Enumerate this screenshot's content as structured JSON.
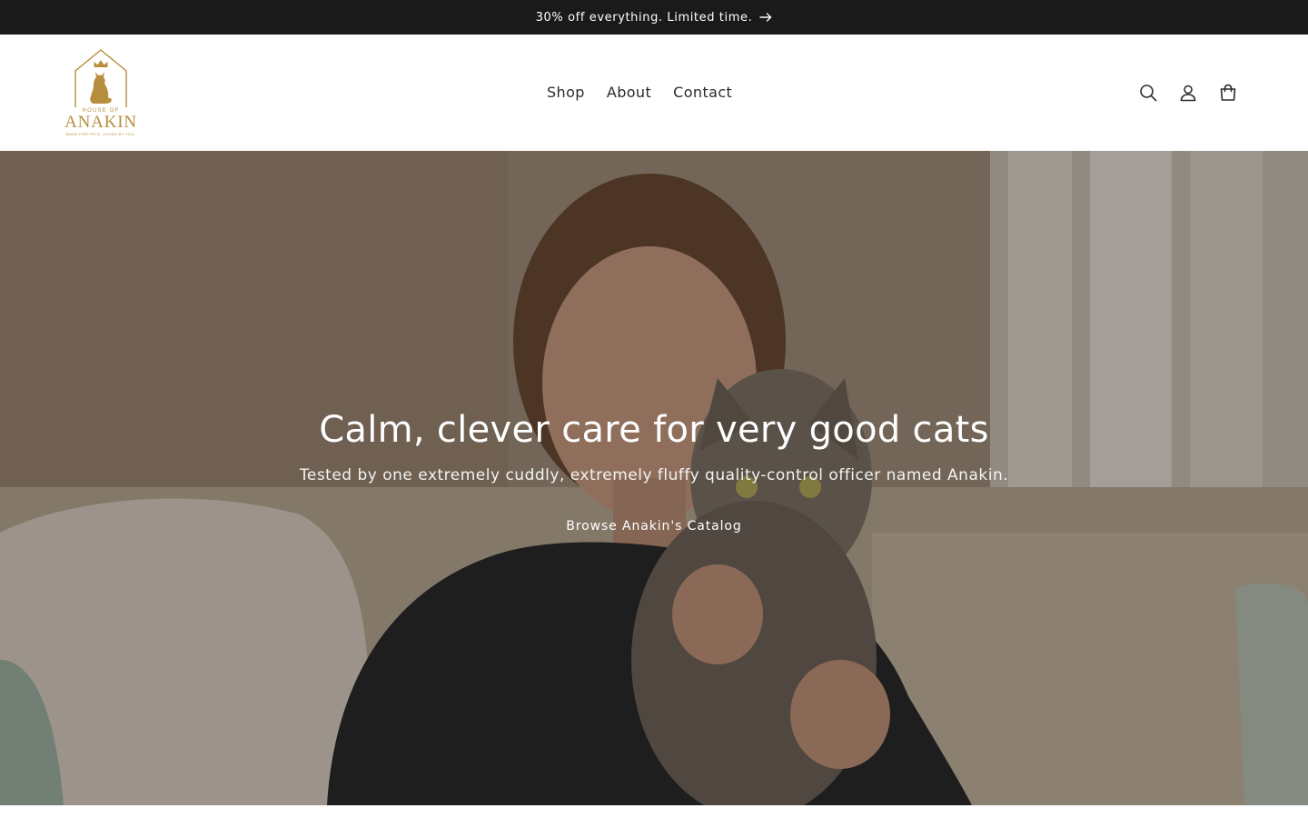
{
  "announcement": {
    "text": "30% off everything. Limited time.",
    "arrow_icon": "arrow-right-icon"
  },
  "header": {
    "logo": {
      "house_of": "HOUSE OF",
      "name": "ANAKIN",
      "tagline": "MADE FOR PETS. LOVED BY YOU.",
      "color": "#b78e3e"
    },
    "nav": [
      {
        "label": "Shop"
      },
      {
        "label": "About"
      },
      {
        "label": "Contact"
      }
    ],
    "icons": [
      "search-icon",
      "account-icon",
      "cart-icon"
    ]
  },
  "hero": {
    "title": "Calm, clever care for very good cats",
    "subtitle": "Tested by one extremely cuddly, extremely fluffy quality-control officer named Anakin.",
    "cta_label": "Browse Anakin's Catalog",
    "image": "woman-holding-tabby-cat-on-sofa"
  },
  "colors": {
    "announcement_bg": "#1a1a1a",
    "text_dark": "#121212",
    "brand_gold": "#b78e3e"
  }
}
